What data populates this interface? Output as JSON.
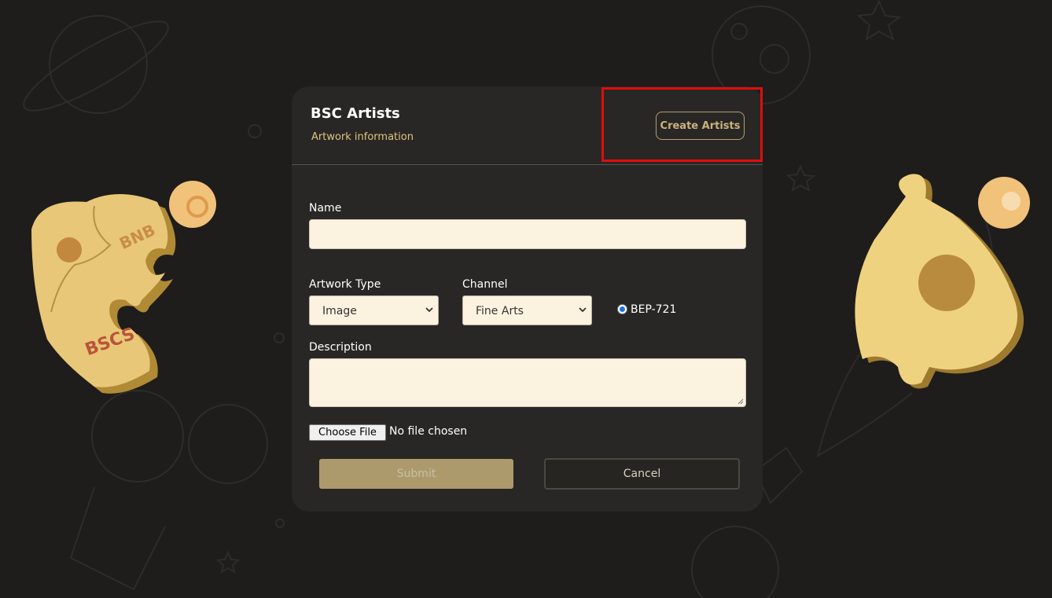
{
  "card": {
    "title": "BSC Artists",
    "subtitle": "Artwork information",
    "create_button": "Create Artists"
  },
  "form": {
    "name_label": "Name",
    "name_value": "",
    "artwork_type_label": "Artwork Type",
    "artwork_type_selected": "Image",
    "channel_label": "Channel",
    "channel_selected": "Fine Arts",
    "standard_option": "BEP-721",
    "standard_selected": true,
    "description_label": "Description",
    "description_value": "",
    "file_button": "Choose File",
    "file_status": "No file chosen",
    "submit_label": "Submit",
    "cancel_label": "Cancel"
  },
  "decorations": {
    "left_puzzle_text_1": "BNB",
    "left_puzzle_text_2": "BSCS"
  },
  "colors": {
    "background": "#1e1d1b",
    "card": "#282725",
    "accent_gold": "#e1c57f",
    "input_bg": "#fcf2e0",
    "highlight": "#e00d0d",
    "submit_bg": "#ad9a6c"
  }
}
